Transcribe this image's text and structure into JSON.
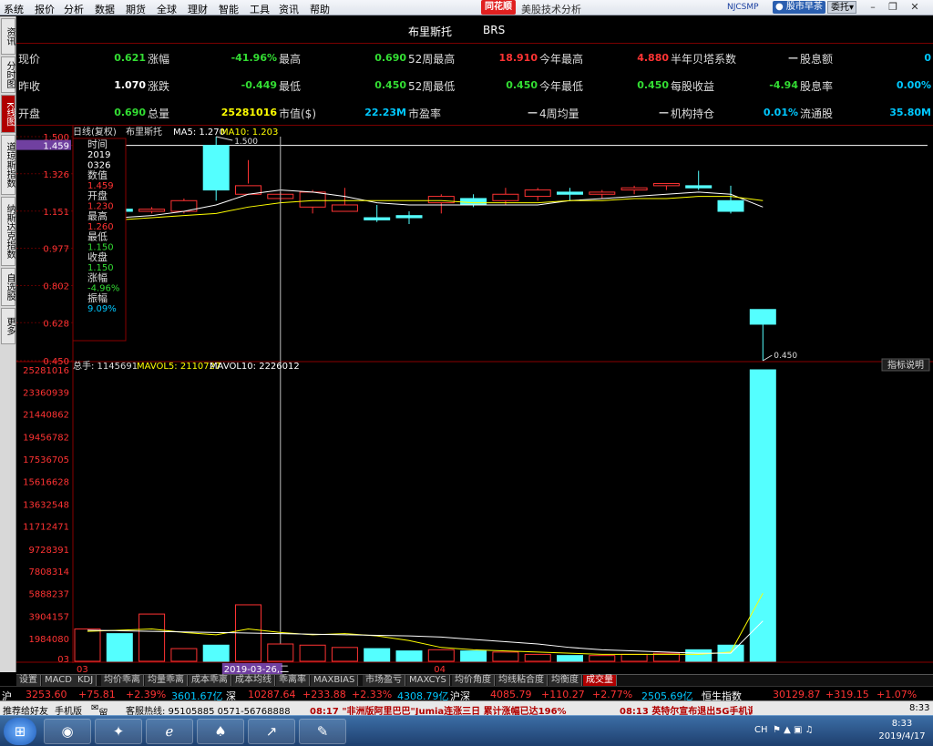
{
  "menubar": {
    "items": [
      "系统",
      "报价",
      "分析",
      "数据",
      "期货",
      "全球",
      "理财",
      "智能",
      "工具",
      "资讯",
      "帮助"
    ],
    "logo": "同花顺",
    "app_title": "美股技术分析",
    "user": "NJCSMP",
    "news_button": "股市早茶",
    "trade_button": "委托"
  },
  "side_tabs": [
    "资讯",
    "分时图",
    "K线图",
    "道琼斯指数",
    "纳斯达克指数",
    "自选股",
    "更多"
  ],
  "stock": {
    "name": "布里斯托",
    "code": "BRS"
  },
  "quote_rows": [
    [
      {
        "label": "现价",
        "value": "0.621",
        "color": "#33dd33"
      },
      {
        "label": "涨幅",
        "value": "-41.96%",
        "color": "#33dd33"
      },
      {
        "label": "最高",
        "value": "0.690",
        "color": "#33dd33"
      },
      {
        "label": "52周最高",
        "value": "18.910",
        "color": "#ff3333"
      },
      {
        "label": "今年最高",
        "value": "4.880",
        "color": "#ff3333"
      },
      {
        "label": "半年贝塔系数",
        "value": "—",
        "color": "#dddddd"
      },
      {
        "label": "股息额",
        "value": "0",
        "color": "#00c8ff"
      }
    ],
    [
      {
        "label": "昨收",
        "value": "1.070",
        "color": "#ffffff"
      },
      {
        "label": "涨跌",
        "value": "-0.449",
        "color": "#33dd33"
      },
      {
        "label": "最低",
        "value": "0.450",
        "color": "#33dd33"
      },
      {
        "label": "52周最低",
        "value": "0.450",
        "color": "#33dd33"
      },
      {
        "label": "今年最低",
        "value": "0.450",
        "color": "#33dd33"
      },
      {
        "label": "每股收益",
        "value": "-4.94",
        "color": "#33dd33"
      },
      {
        "label": "股息率",
        "value": "0.00%",
        "color": "#00c8ff"
      }
    ],
    [
      {
        "label": "开盘",
        "value": "0.690",
        "color": "#33dd33"
      },
      {
        "label": "总量",
        "value": "25281016",
        "color": "#ffff00"
      },
      {
        "label": "市值($)",
        "value": "22.23M",
        "color": "#00c8ff"
      },
      {
        "label": "市盈率",
        "value": "—",
        "color": "#dddddd"
      },
      {
        "label": "4周均量",
        "value": "—",
        "color": "#dddddd"
      },
      {
        "label": "机构持仓",
        "value": "0.01%",
        "color": "#00c8ff"
      },
      {
        "label": "流通股",
        "value": "35.80M",
        "color": "#00c8ff"
      }
    ]
  ],
  "kline": {
    "legend_title": "日线(复权)",
    "legend_name": "布里斯托",
    "ma5": "MA5: 1.270",
    "ma10": "MA10: 1.203",
    "price_ticks": [
      "1.500",
      "1.459",
      "1.326",
      "1.151",
      "0.977",
      "0.802",
      "0.628",
      "0.450"
    ],
    "high_label": "1.500",
    "low_label": "0.450"
  },
  "infobox": [
    {
      "label": "时间",
      "value": "2019",
      "color": "#ffffff"
    },
    {
      "label": "",
      "value": "0326",
      "color": "#ffffff"
    },
    {
      "label": "数值",
      "value": "1.459",
      "color": "#ff3333"
    },
    {
      "label": "开盘",
      "value": "1.230",
      "color": "#ff3333"
    },
    {
      "label": "最高",
      "value": "1.260",
      "color": "#ff3333"
    },
    {
      "label": "最低",
      "value": "1.150",
      "color": "#33dd33"
    },
    {
      "label": "收盘",
      "value": "1.150",
      "color": "#33dd33"
    },
    {
      "label": "涨幅",
      "value": "-4.96%",
      "color": "#33dd33"
    },
    {
      "label": "振幅",
      "value": "9.09%",
      "color": "#00c8ff"
    }
  ],
  "volume": {
    "legend_total": "总手: 1145691",
    "legend_mavol5": "MAVOL5: 2110727",
    "legend_mavol10": "MAVOL10: 2226012",
    "explain_button": "指标说明",
    "ticks": [
      "25281016",
      "23360939",
      "21440862",
      "19456782",
      "17536705",
      "15616628",
      "13632548",
      "11712471",
      "9728391",
      "7808314",
      "5888237",
      "3904157",
      "1984080"
    ]
  },
  "xaxis": {
    "labels": [
      "03",
      "2019-03-26,二",
      "04"
    ]
  },
  "chart_data": {
    "type": "candlestick",
    "x": [
      "03-19",
      "03-20",
      "03-21",
      "03-22",
      "03-25",
      "03-26",
      "03-27",
      "03-28",
      "03-29",
      "04-01",
      "04-02",
      "04-03",
      "04-04",
      "04-05",
      "04-08",
      "04-09",
      "04-10",
      "04-11",
      "04-12",
      "04-15",
      "04-16",
      "04-17"
    ],
    "open": [
      1.12,
      1.16,
      1.15,
      1.15,
      1.459,
      1.23,
      1.21,
      1.17,
      1.15,
      1.12,
      1.13,
      1.19,
      1.21,
      1.2,
      1.22,
      1.24,
      1.23,
      1.25,
      1.27,
      1.27,
      1.2,
      0.69
    ],
    "high": [
      1.19,
      1.17,
      1.17,
      1.21,
      1.5,
      1.39,
      1.24,
      1.25,
      1.26,
      1.18,
      1.15,
      1.23,
      1.23,
      1.26,
      1.26,
      1.26,
      1.25,
      1.27,
      1.28,
      1.34,
      1.27,
      0.69
    ],
    "low": [
      1.09,
      1.1,
      1.14,
      1.14,
      1.2,
      1.28,
      1.19,
      1.14,
      1.15,
      1.1,
      1.09,
      1.14,
      1.17,
      1.18,
      1.2,
      1.2,
      1.21,
      1.23,
      1.25,
      1.25,
      1.14,
      0.45
    ],
    "close": [
      1.17,
      1.15,
      1.16,
      1.2,
      1.25,
      1.27,
      1.23,
      1.24,
      1.18,
      1.11,
      1.12,
      1.22,
      1.18,
      1.23,
      1.25,
      1.23,
      1.24,
      1.26,
      1.28,
      1.26,
      1.15,
      0.621
    ],
    "ma5": [
      1.12,
      1.12,
      1.13,
      1.15,
      1.18,
      1.23,
      1.25,
      1.24,
      1.22,
      1.19,
      1.18,
      1.18,
      1.18,
      1.18,
      1.18,
      1.2,
      1.21,
      1.22,
      1.23,
      1.24,
      1.23,
      1.17
    ],
    "ma10": [
      1.1,
      1.11,
      1.12,
      1.13,
      1.14,
      1.17,
      1.19,
      1.2,
      1.2,
      1.2,
      1.2,
      1.2,
      1.19,
      1.19,
      1.19,
      1.2,
      1.2,
      1.21,
      1.21,
      1.22,
      1.22,
      1.2
    ],
    "volume": [
      2800000,
      2400000,
      4100000,
      1100000,
      1400000,
      4900000,
      1500000,
      1400000,
      1200000,
      1100000,
      900000,
      1000000,
      900000,
      800000,
      600000,
      500000,
      500000,
      600000,
      700000,
      1000000,
      1400000,
      25281016
    ],
    "mavol5": [
      2600000,
      2700000,
      2800000,
      2500000,
      2300000,
      2800000,
      2500000,
      2300000,
      2400000,
      2200000,
      1800000,
      1200000,
      1000000,
      900000,
      800000,
      700000,
      600000,
      600000,
      600000,
      600000,
      800000,
      5900000
    ],
    "mavol10": [
      2700000,
      2650000,
      2600000,
      2550000,
      2500000,
      2450000,
      2400000,
      2350000,
      2300000,
      2250000,
      2200000,
      2100000,
      1900000,
      1700000,
      1500000,
      1200000,
      1000000,
      900000,
      800000,
      700000,
      700000,
      3500000
    ],
    "ylim_price": [
      0.45,
      1.5
    ],
    "ylim_volume": [
      0,
      25281016
    ],
    "cursor_index": 6
  },
  "indicator_tabs": [
    "设置",
    "MACD",
    "KDJ",
    "均价乖离",
    "均量乖离",
    "成本乖离",
    "成本均线",
    "乖离率",
    "MAXBIAS",
    "市场盈亏",
    "MAXCYS",
    "均价角度",
    "均线粘合度",
    "均衡度",
    "成交量"
  ],
  "active_indicator": "成交量",
  "indexbar": {
    "sh_label": "沪",
    "sh_value": "3253.60",
    "sh_change": "+75.81",
    "sh_pct": "+2.39%",
    "sh_amount": "3601.67亿",
    "sz_label": "深",
    "sz_value": "10287.64",
    "sz_change": "+233.88",
    "sz_pct": "+2.33%",
    "sz_amount": "4308.79亿",
    "hs_label": "沪深",
    "hs_value": "4085.79",
    "hs_change": "+110.27",
    "hs_pct": "+2.77%",
    "hs_amount": "2505.69亿",
    "hsi_label": "恒生指数",
    "hsi_value": "30129.87",
    "hsi_change": "+319.15",
    "hsi_pct": "+1.07%"
  },
  "newsbar": {
    "item1": "推荐给好友",
    "item2": "手机版",
    "item3": "留言",
    "item4": "客服热线: 95105885 0571-56768888",
    "news1": "08:17 \"非洲版阿里巴巴\"Jumia连涨三日 累计涨幅已达196%",
    "news2": "08:13 英特尔宣布退出5G手机调",
    "time": "8:33"
  },
  "taskbar": {
    "lang": "CH",
    "time": "8:33",
    "date": "2019/4/17"
  }
}
